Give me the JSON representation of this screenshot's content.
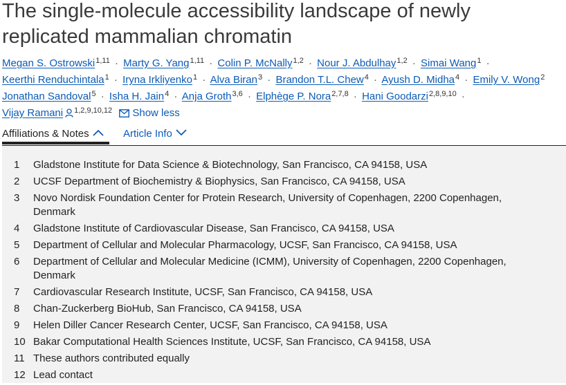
{
  "title": "The single-molecule accessibility landscape of newly replicated mammalian chromatin",
  "authors": [
    {
      "name": "Megan S. Ostrowski",
      "sup": "1,11"
    },
    {
      "name": "Marty G. Yang",
      "sup": "1,11"
    },
    {
      "name": "Colin P. McNally",
      "sup": "1,2"
    },
    {
      "name": "Nour J. Abdulhay",
      "sup": "1,2"
    },
    {
      "name": "Simai Wang",
      "sup": "1"
    },
    {
      "name": "Keerthi Renduchintala",
      "sup": "1"
    },
    {
      "name": "Iryna Irkliyenko",
      "sup": "1"
    },
    {
      "name": "Alva Biran",
      "sup": "3"
    },
    {
      "name": "Brandon T.L. Chew",
      "sup": "4"
    },
    {
      "name": "Ayush D. Midha",
      "sup": "4"
    },
    {
      "name": "Emily V. Wong",
      "sup": "2"
    },
    {
      "name": "Jonathan Sandoval",
      "sup": "5"
    },
    {
      "name": "Isha H. Jain",
      "sup": "4"
    },
    {
      "name": "Anja Groth",
      "sup": "3,6"
    },
    {
      "name": "Elphège P. Nora",
      "sup": "2,7,8"
    },
    {
      "name": "Hani Goodarzi",
      "sup": "2,8,9,10"
    },
    {
      "name": "Vijay Ramani",
      "sup": "1,2,9,10,12"
    }
  ],
  "separator": "·",
  "show_less": "Show less",
  "icons": {
    "corresponding": "person-icon",
    "email": "mail-icon"
  },
  "tabs": {
    "affiliations": "Affiliations & Notes",
    "article_info": "Article Info"
  },
  "affiliations": [
    {
      "num": "1",
      "text": "Gladstone Institute for Data Science & Biotechnology, San Francisco, CA 94158, USA"
    },
    {
      "num": "2",
      "text": "UCSF Department of Biochemistry & Biophysics, San Francisco, CA 94158, USA"
    },
    {
      "num": "3",
      "text": "Novo Nordisk Foundation Center for Protein Research, University of Copenhagen, 2200 Copenhagen, Denmark"
    },
    {
      "num": "4",
      "text": "Gladstone Institute of Cardiovascular Disease, San Francisco, CA 94158, USA"
    },
    {
      "num": "5",
      "text": "Department of Cellular and Molecular Pharmacology, UCSF, San Francisco, CA 94158, USA"
    },
    {
      "num": "6",
      "text": "Department of Cellular and Molecular Medicine (ICMM), University of Copenhagen, 2200 Copenhagen, Denmark"
    },
    {
      "num": "7",
      "text": "Cardiovascular Research Institute, UCSF, San Francisco, CA 94158, USA"
    },
    {
      "num": "8",
      "text": "Chan-Zuckerberg BioHub, San Francisco, CA 94158, USA"
    },
    {
      "num": "9",
      "text": "Helen Diller Cancer Research Center, UCSF, San Francisco, CA 94158, USA"
    },
    {
      "num": "10",
      "text": "Bakar Computational Health Sciences Institute, UCSF, San Francisco, CA 94158, USA"
    },
    {
      "num": "11",
      "text": "These authors contributed equally"
    },
    {
      "num": "12",
      "text": "Lead contact"
    }
  ]
}
